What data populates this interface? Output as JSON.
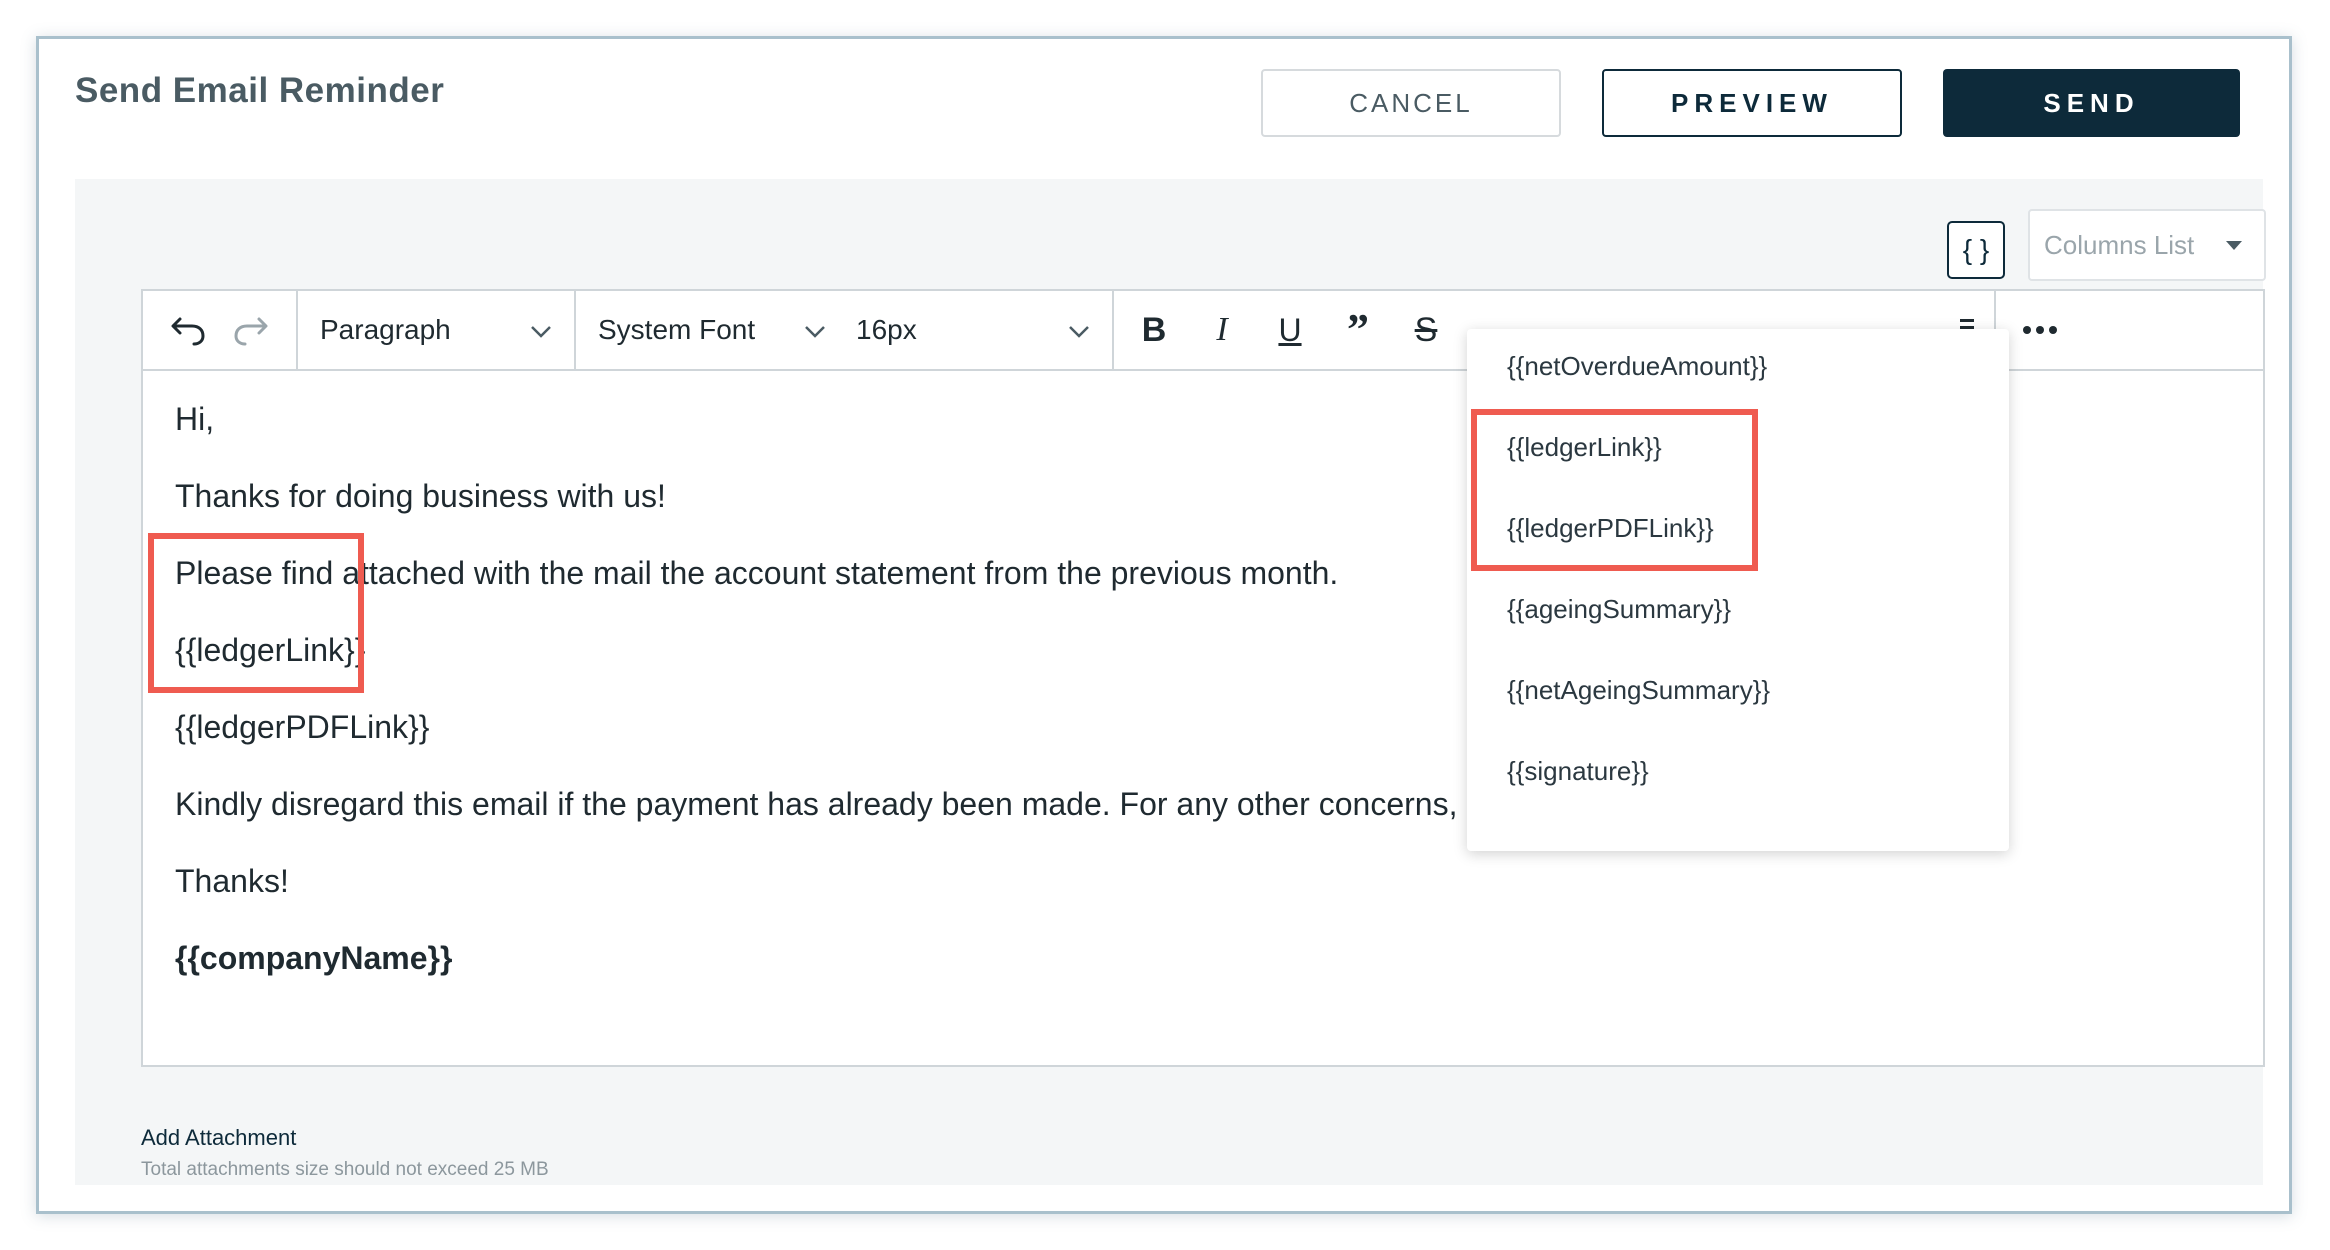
{
  "header": {
    "title": "Send Email Reminder",
    "cancel_label": "CANCEL",
    "preview_label": "PREVIEW",
    "send_label": "SEND"
  },
  "panel": {
    "variable_button_label": "{ }",
    "columns_list_placeholder": "Columns List"
  },
  "toolbar": {
    "block_format": "Paragraph",
    "font_family": "System Font",
    "font_size": "16px",
    "icons": [
      "undo-icon",
      "redo-icon",
      "bold-icon",
      "italic-icon",
      "underline-icon",
      "blockquote-icon",
      "strikethrough-icon",
      "list-icon",
      "more-icon"
    ]
  },
  "editor": {
    "lines": [
      "Hi,",
      "Thanks for doing business with us!",
      "Please find attached with the mail the account statement from the previous month.",
      "{{ledgerLink}}",
      "{{ledgerPDFLink}}",
      "Kindly disregard this email if the payment has already been made. For any other concerns, please reply to this email.",
      "Thanks!",
      "{{companyName}}"
    ]
  },
  "variables_dropdown": {
    "items": [
      "{{netOverdueAmount}}",
      "{{ledgerLink}}",
      "{{ledgerPDFLink}}",
      "{{ageingSummary}}",
      "{{netAgeingSummary}}",
      "{{signature}}"
    ]
  },
  "attachments": {
    "add_label": "Add Attachment",
    "note": "Total attachments size should not exceed 25 MB"
  },
  "colors": {
    "primary": "#0d2a3a",
    "highlight": "#ef5b50",
    "border": "#cfd5d9"
  }
}
